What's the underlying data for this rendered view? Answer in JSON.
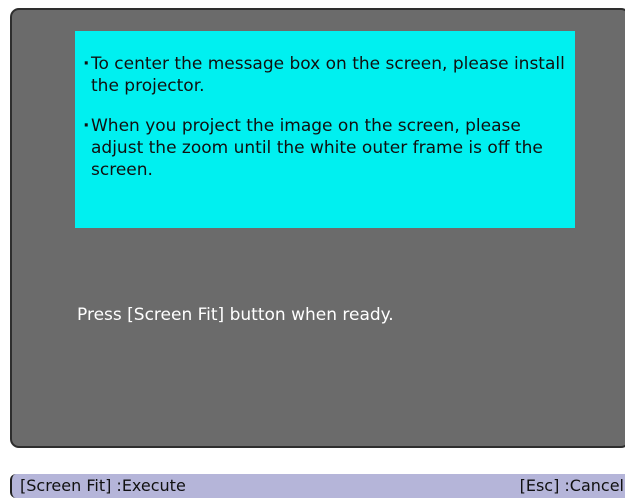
{
  "message_box": {
    "bullet_symbol": "·",
    "bullets": [
      "To center the message box on the screen, please install the projector.",
      "When you project the image on the screen, please adjust the zoom until the white outer frame is off the screen."
    ]
  },
  "prompt": {
    "text": "Press [Screen Fit] button when ready."
  },
  "footer": {
    "execute_label": "[Screen Fit] :Execute",
    "cancel_label": "[Esc] :Cancel"
  },
  "colors": {
    "panel_background": "#6b6b6b",
    "message_background": "#00f0f0",
    "footer_background": "#b5b5d9"
  }
}
